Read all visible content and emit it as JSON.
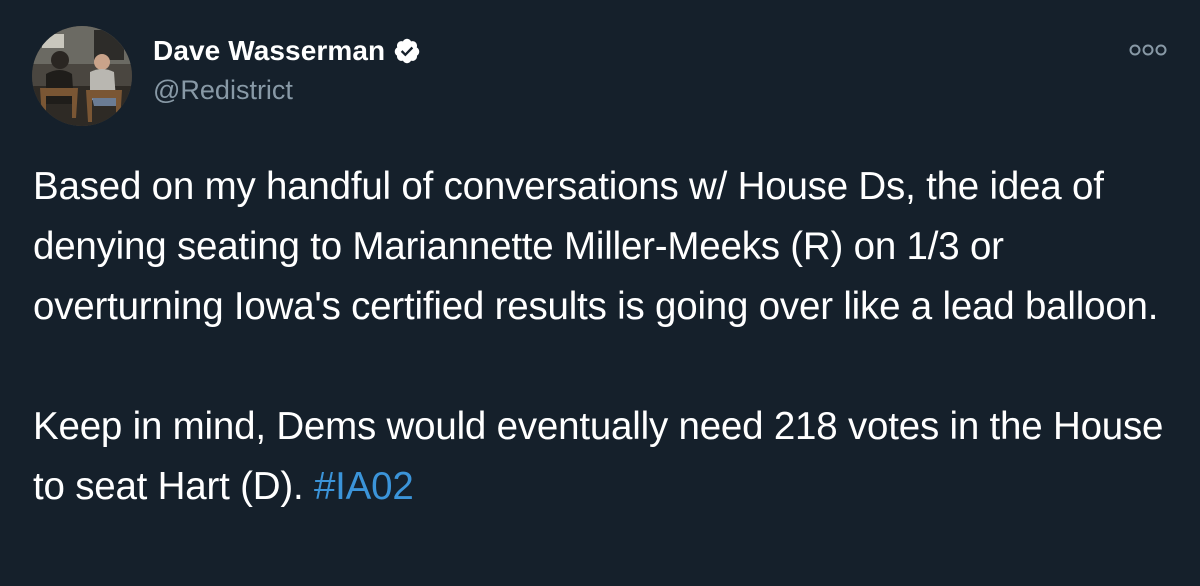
{
  "author": {
    "display_name": "Dave Wasserman",
    "handle": "@Redistrict",
    "verified": true,
    "avatar_icon": "profile-photo"
  },
  "tweet": {
    "paragraph_1": "Based on my handful of conversations w/ House Ds, the idea of denying seating to Mariannette Miller-Meeks (R) on 1/3 or overturning Iowa's certified results is going over like a lead balloon.",
    "paragraph_2_text": "Keep in mind, Dems would eventually need 218 votes in the House to seat Hart (D). ",
    "hashtag": "#IA02"
  },
  "icons": {
    "verified": "verified-badge-icon",
    "more": "more-options-icon"
  },
  "colors": {
    "background": "#15202b",
    "text": "#ffffff",
    "secondary_text": "#8899a6",
    "link": "#3b94d9"
  }
}
